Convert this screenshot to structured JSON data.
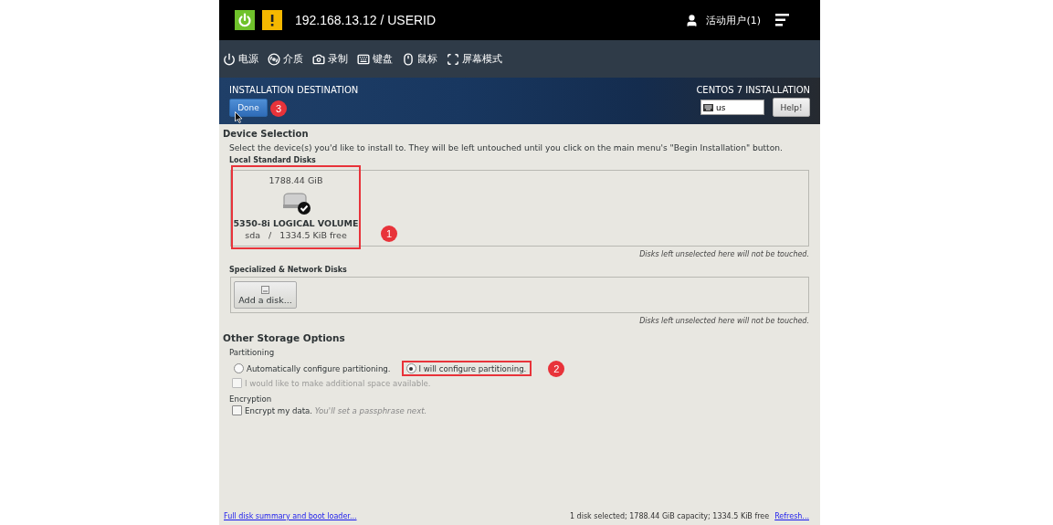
{
  "console": {
    "address": "192.168.13.12 / USERID",
    "user": "活动用户(1)",
    "power_on": true,
    "warning": true
  },
  "toolbar": [
    {
      "kind": "power",
      "label": "电源"
    },
    {
      "kind": "media",
      "label": "介质"
    },
    {
      "kind": "record",
      "label": "录制"
    },
    {
      "kind": "keyboard",
      "label": "键盘"
    },
    {
      "kind": "mouse",
      "label": "鼠标"
    },
    {
      "kind": "screen",
      "label": "屏幕模式"
    }
  ],
  "installer": {
    "title": "INSTALLATION DESTINATION",
    "done_button": "Done",
    "done_annotation": "3",
    "product": "CENTOS 7 INSTALLATION",
    "keyboard_layout": "us",
    "help_button": "Help!"
  },
  "device_selection": {
    "heading": "Device Selection",
    "intro": "Select the device(s) you'd like to install to.  They will be left untouched until you click on the main menu's \"Begin Installation\" button.",
    "local": {
      "heading": "Local Standard Disks",
      "disks": [
        {
          "size": "1788.44 GiB",
          "name": "5350-8i LOGICAL VOLUME",
          "detail": "sda   /   1334.5 KiB free",
          "selected": true,
          "boxed": true,
          "annotation": "1"
        }
      ],
      "note": "Disks left unselected here will not be touched."
    },
    "network": {
      "heading": "Specialized & Network Disks",
      "add_button": "Add a disk...",
      "note": "Disks left unselected here will not be touched."
    }
  },
  "other_options": {
    "heading": "Other Storage Options",
    "partitioning": {
      "heading": "Partitioning",
      "options": [
        {
          "label": "Automatically configure partitioning.",
          "selected": false,
          "boxed": false
        },
        {
          "label": "I will configure partitioning.",
          "selected": true,
          "boxed": true,
          "annotation": "2"
        }
      ],
      "additional_space": {
        "label": "I would like to make additional space available.",
        "checked": false,
        "disabled": true
      }
    },
    "encryption": {
      "heading": "Encryption",
      "label": "Encrypt my data.",
      "hint": "You'll set a passphrase next.",
      "checked": false
    }
  },
  "footer": {
    "link": "Full disk summary and boot loader...",
    "summary": "1 disk selected; 1788.44 GiB capacity; 1334.5 KiB free",
    "refresh": "Refresh..."
  }
}
